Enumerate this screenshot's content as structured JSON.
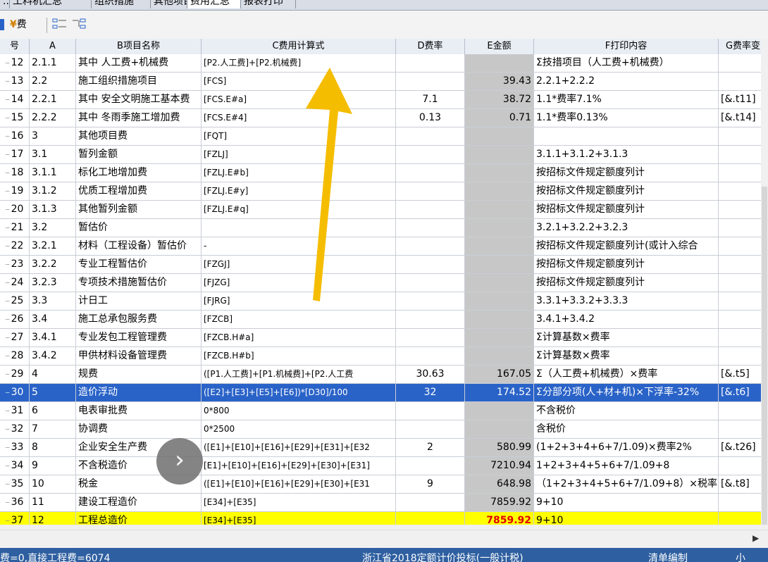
{
  "tabs": [
    "...",
    "工料机汇总",
    "组织措施",
    "其他项目",
    "费用汇总",
    "报表打印"
  ],
  "toolbar": {
    "fee_label": "费"
  },
  "columns": {
    "no": "号",
    "a": "A",
    "b": "B项目名称",
    "c": "C费用计算式",
    "d": "D费率",
    "e": "E金额",
    "f": "F打印内容",
    "g": "G费率变"
  },
  "rows": [
    {
      "no": "12",
      "a": "2.1.1",
      "b": "其中 人工费+机械费",
      "c": "[P2.人工费]+[P2.机械费]",
      "d": "",
      "e": "",
      "f": "Σ技措项目（人工费+机械费）",
      "g": ""
    },
    {
      "no": "13",
      "a": "2.2",
      "b": "施工组织措施项目",
      "c": "[FCS]",
      "d": "",
      "e": "39.43",
      "f": "2.2.1+2.2.2",
      "g": ""
    },
    {
      "no": "14",
      "a": "2.2.1",
      "b": "其中 安全文明施工基本费",
      "c": "[FCS.E#a]",
      "d": "7.1",
      "e": "38.72",
      "f": "1.1*费率7.1%",
      "g": "[&.t11]"
    },
    {
      "no": "15",
      "a": "2.2.2",
      "b": "其中 冬雨季施工增加费",
      "c": "[FCS.E#4]",
      "d": "0.13",
      "e": "0.71",
      "f": "1.1*费率0.13%",
      "g": "[&.t14]"
    },
    {
      "no": "16",
      "a": "3",
      "b": "其他项目费",
      "c": "[FQT]",
      "d": "",
      "e": "",
      "f": "",
      "g": ""
    },
    {
      "no": "17",
      "a": "3.1",
      "b": "暂列金额",
      "c": "[FZLJ]",
      "d": "",
      "e": "",
      "f": "3.1.1+3.1.2+3.1.3",
      "g": ""
    },
    {
      "no": "18",
      "a": "3.1.1",
      "b": "标化工地增加费",
      "c": "[FZLJ.E#b]",
      "d": "",
      "e": "",
      "f": "按招标文件规定额度列计",
      "g": ""
    },
    {
      "no": "19",
      "a": "3.1.2",
      "b": "优质工程增加费",
      "c": "[FZLJ.E#y]",
      "d": "",
      "e": "",
      "f": "按招标文件规定额度列计",
      "g": ""
    },
    {
      "no": "20",
      "a": "3.1.3",
      "b": "其他暂列金额",
      "c": "[FZLJ.E#q]",
      "d": "",
      "e": "",
      "f": "按招标文件规定额度列计",
      "g": ""
    },
    {
      "no": "21",
      "a": "3.2",
      "b": "暂估价",
      "c": "",
      "d": "",
      "e": "",
      "f": "3.2.1+3.2.2+3.2.3",
      "g": ""
    },
    {
      "no": "22",
      "a": "3.2.1",
      "b": "材料（工程设备）暂估价",
      "c": "-",
      "d": "",
      "e": "",
      "f": "按招标文件规定额度列计(或计入综合",
      "g": ""
    },
    {
      "no": "23",
      "a": "3.2.2",
      "b": "专业工程暂估价",
      "c": "[FZGJ]",
      "d": "",
      "e": "",
      "f": "按招标文件规定额度列计",
      "g": ""
    },
    {
      "no": "24",
      "a": "3.2.3",
      "b": "专项技术措施暂估价",
      "c": "[FJZG]",
      "d": "",
      "e": "",
      "f": "按招标文件规定额度列计",
      "g": ""
    },
    {
      "no": "25",
      "a": "3.3",
      "b": "计日工",
      "c": "[FJRG]",
      "d": "",
      "e": "",
      "f": "3.3.1+3.3.2+3.3.3",
      "g": ""
    },
    {
      "no": "26",
      "a": "3.4",
      "b": "施工总承包服务费",
      "c": "[FZCB]",
      "d": "",
      "e": "",
      "f": "3.4.1+3.4.2",
      "g": ""
    },
    {
      "no": "27",
      "a": "3.4.1",
      "b": "专业发包工程管理费",
      "c": "[FZCB.H#a]",
      "d": "",
      "e": "",
      "f": "Σ计算基数×费率",
      "g": ""
    },
    {
      "no": "28",
      "a": "3.4.2",
      "b": "甲供材料设备管理费",
      "c": "[FZCB.H#b]",
      "d": "",
      "e": "",
      "f": "Σ计算基数×费率",
      "g": ""
    },
    {
      "no": "29",
      "a": "4",
      "b": "规费",
      "c": "([P1.人工费]+[P1.机械费]+[P2.人工费",
      "d": "30.63",
      "e": "167.05",
      "f": "Σ（人工费+机械费）×费率",
      "g": "[&.t5]"
    },
    {
      "no": "30",
      "a": "5",
      "b": "造价浮动",
      "c": "([E2]+[E3]+[E5]+[E6])*[D30]/100",
      "d": "32",
      "e": "174.52",
      "f": "Σ分部分项(人+材+机)×下浮率-32%",
      "g": "[&.t6]"
    },
    {
      "no": "31",
      "a": "6",
      "b": "电表审批费",
      "c": "0*800",
      "d": "",
      "e": "",
      "f": "不含税价",
      "g": ""
    },
    {
      "no": "32",
      "a": "7",
      "b": "协调费",
      "c": "0*2500",
      "d": "",
      "e": "",
      "f": "含税价",
      "g": ""
    },
    {
      "no": "33",
      "a": "8",
      "b": "企业安全生产费",
      "c": "([E1]+[E10]+[E16]+[E29]+[E31]+[E32",
      "d": "2",
      "e": "580.99",
      "f": "(1+2+3+4+6+7/1.09)×费率2%",
      "g": "[&.t26]"
    },
    {
      "no": "34",
      "a": "9",
      "b": "不含税造价",
      "c": "[E1]+[E10]+[E16]+[E29]+[E30]+[E31]",
      "d": "",
      "e": "7210.94",
      "f": "1+2+3+4+5+6+7/1.09+8",
      "g": ""
    },
    {
      "no": "35",
      "a": "10",
      "b": "税金",
      "c": "([E1]+[E10]+[E16]+[E29]+[E30]+[E31",
      "d": "9",
      "e": "648.98",
      "f": "（1+2+3+4+5+6+7/1.09+8）×税率",
      "g": "[&.t8]"
    },
    {
      "no": "36",
      "a": "11",
      "b": "建设工程造价",
      "c": "[E34]+[E35]",
      "d": "",
      "e": "7859.92",
      "f": "9+10",
      "g": ""
    },
    {
      "no": "37",
      "a": "12",
      "b": "工程总造价",
      "c": "[E34]+[E35]",
      "d": "",
      "e": "7859.92",
      "f": "9+10",
      "g": ""
    }
  ],
  "selected_row": 18,
  "total_row": 25,
  "status": {
    "left": "费=0,直接工程费=6074",
    "center": "浙江省2018定额计价投标(一般计税)",
    "right": "清单编制",
    "far_right": "小"
  },
  "colors": {
    "selected": "#2a63c8",
    "total": "#ffff00",
    "arrow": "#f5bd00",
    "status_bar": "#2e5fa0"
  }
}
